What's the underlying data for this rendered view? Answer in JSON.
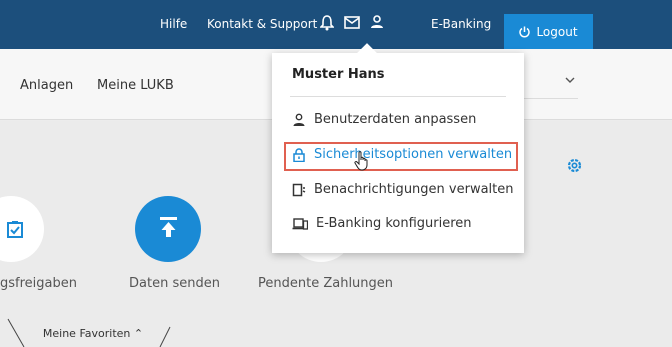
{
  "topbar": {
    "help": "Hilfe",
    "contact": "Kontakt & Support",
    "ebanking": "E-Banking",
    "logout": "Logout",
    "bell_icon": "bell-icon",
    "mail_icon": "mail-icon",
    "user_icon": "user-icon",
    "power_icon": "power-icon"
  },
  "subnav": {
    "items": [
      "Anlagen",
      "Meine LUKB"
    ]
  },
  "tiles": {
    "freigaben_partial": "gsfreigaben",
    "daten_senden": "Daten senden",
    "pendente": "Pendente Zahlungen"
  },
  "favorites": {
    "label": "Meine Favoriten"
  },
  "dropdown": {
    "user_name": "Muster Hans",
    "items": [
      {
        "label": "Benutzerdaten anpassen",
        "icon": "user-icon"
      },
      {
        "label": "Sicherheitsoptionen verwalten",
        "icon": "lock-icon"
      },
      {
        "label": "Benachrichtigungen verwalten",
        "icon": "device-notification-icon"
      },
      {
        "label": "E-Banking konfigurieren",
        "icon": "devices-icon"
      }
    ]
  },
  "colors": {
    "topbar": "#1c4f7c",
    "accent": "#1a8ad5",
    "highlight": "#e06050"
  }
}
